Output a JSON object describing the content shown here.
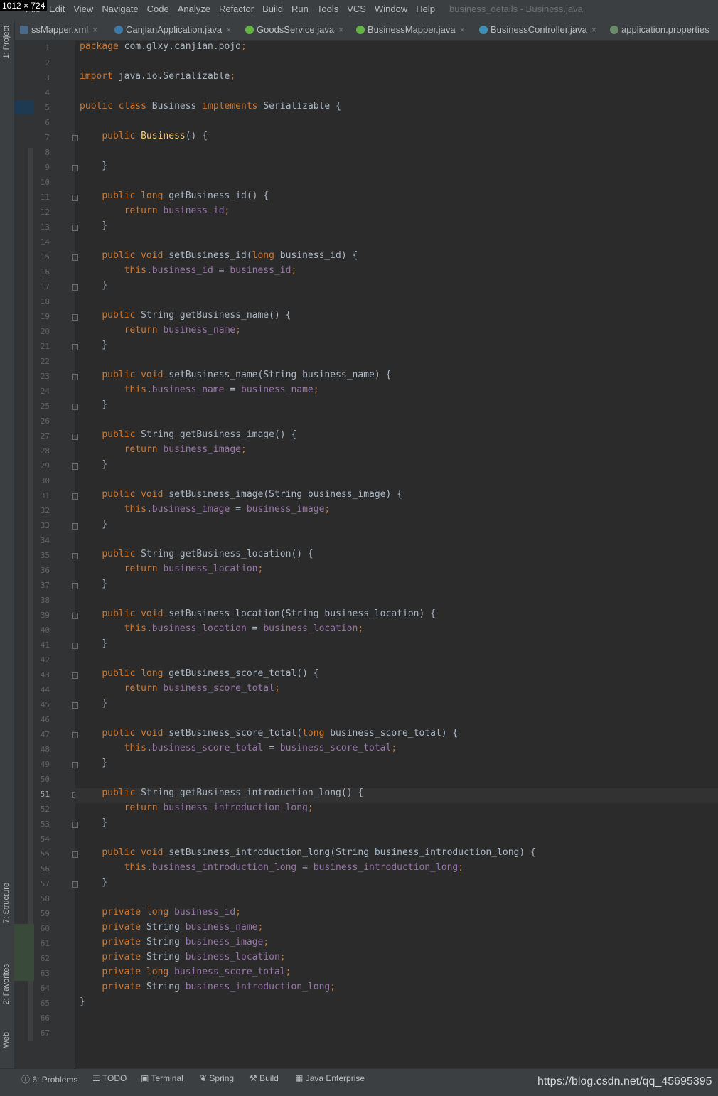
{
  "overlay": {
    "size_badge": "1012 × 724"
  },
  "menubar": {
    "items": [
      "File",
      "Edit",
      "View",
      "Navigate",
      "Code",
      "Analyze",
      "Refactor",
      "Build",
      "Run",
      "Tools",
      "VCS",
      "Window",
      "Help"
    ],
    "window_title": "business_details - Business.java"
  },
  "tabs": [
    {
      "label": "ssMapper.xml",
      "icon": "xml-file-icon"
    },
    {
      "label": "CanjianApplication.java",
      "icon": "spring-class-icon"
    },
    {
      "label": "GoodsService.java",
      "icon": "interface-icon"
    },
    {
      "label": "BusinessMapper.java",
      "icon": "interface-icon"
    },
    {
      "label": "BusinessController.java",
      "icon": "class-icon"
    },
    {
      "label": "application.properties",
      "icon": "properties-icon"
    }
  ],
  "left_strip": {
    "project": "1: Project",
    "structure": "7: Structure",
    "favorites": "2: Favorites",
    "web": "Web"
  },
  "code_lines": [
    "package com.glxy.canjian.pojo;",
    "",
    "import java.io.Serializable;",
    "",
    "public class Business implements Serializable {",
    "",
    "    public Business() {",
    "",
    "    }",
    "",
    "    public long getBusiness_id() {",
    "        return business_id;",
    "    }",
    "",
    "    public void setBusiness_id(long business_id) {",
    "        this.business_id = business_id;",
    "    }",
    "",
    "    public String getBusiness_name() {",
    "        return business_name;",
    "    }",
    "",
    "    public void setBusiness_name(String business_name) {",
    "        this.business_name = business_name;",
    "    }",
    "",
    "    public String getBusiness_image() {",
    "        return business_image;",
    "    }",
    "",
    "    public void setBusiness_image(String business_image) {",
    "        this.business_image = business_image;",
    "    }",
    "",
    "    public String getBusiness_location() {",
    "        return business_location;",
    "    }",
    "",
    "    public void setBusiness_location(String business_location) {",
    "        this.business_location = business_location;",
    "    }",
    "",
    "    public long getBusiness_score_total() {",
    "        return business_score_total;",
    "    }",
    "",
    "    public void setBusiness_score_total(long business_score_total) {",
    "        this.business_score_total = business_score_total;",
    "    }",
    "",
    "    public String getBusiness_introduction_long() {",
    "        return business_introduction_long;",
    "    }",
    "",
    "    public void setBusiness_introduction_long(String business_introduction_long) {",
    "        this.business_introduction_long = business_introduction_long;",
    "    }",
    "",
    "    private long business_id;",
    "    private String business_name;",
    "    private String business_image;",
    "    private String business_location;",
    "    private long business_score_total;",
    "    private String business_introduction_long;",
    "}",
    "",
    ""
  ],
  "current_line": 51,
  "statusbar": {
    "items": [
      {
        "label": "6: Problems",
        "icon": "info-icon"
      },
      {
        "label": "TODO",
        "icon": "list-icon"
      },
      {
        "label": "Terminal",
        "icon": "terminal-icon"
      },
      {
        "label": "Spring",
        "icon": "spring-leaf-icon"
      },
      {
        "label": "Build",
        "icon": "hammer-icon"
      },
      {
        "label": "Java Enterprise",
        "icon": "enterprise-icon"
      }
    ],
    "watermark": "https://blog.csdn.net/qq_45695395"
  },
  "colors": {
    "keyword": "#cc7832",
    "method": "#ffc66d",
    "field": "#9876aa",
    "text": "#a9b7c6",
    "background": "#2b2b2b"
  }
}
